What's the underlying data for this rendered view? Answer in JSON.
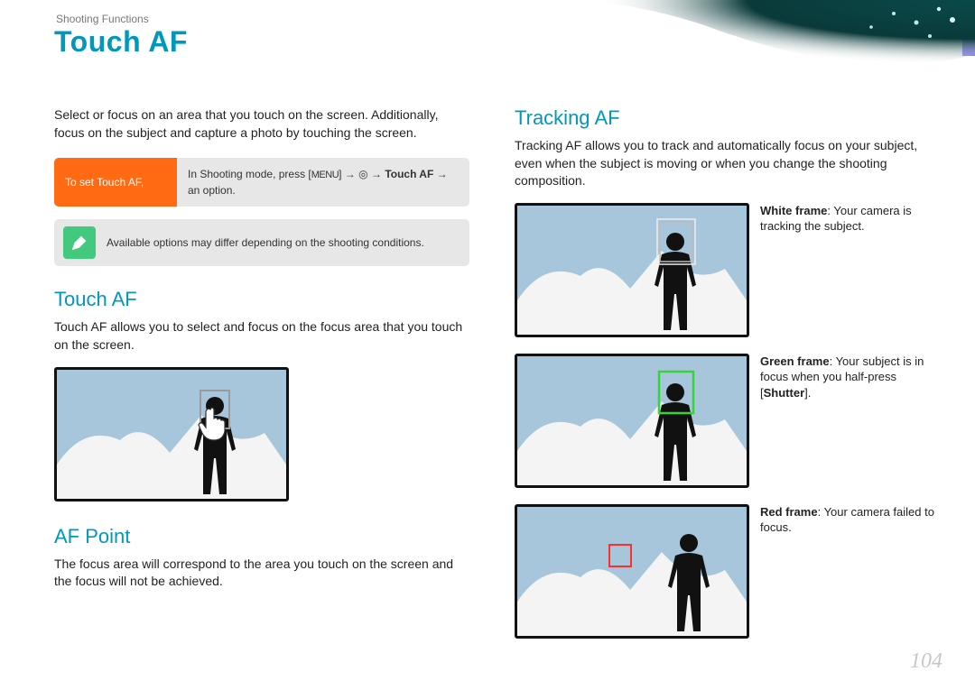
{
  "header": {
    "breadcrumb": "Shooting Functions",
    "title": "Touch AF"
  },
  "left": {
    "intro": "Select or focus on an area that you touch on the screen. Additionally, focus on the subject and capture a photo by touching the screen.",
    "step_label": "To set Touch AF,",
    "step_text_prefix": "In Shooting mode, press [",
    "step_menu": "MENU",
    "step_text_mid1": "] → ",
    "step_text_mid2": " → ",
    "step_text_bold": "Touch AF",
    "step_text_mid3": " → an option.",
    "note": "Available options may differ depending on the shooting conditions.",
    "h2a": "Touch AF",
    "body_a": "Touch AF allows you to select and focus on the focus area that you touch on the screen.",
    "h2b": "AF Point",
    "body_b": "The focus area will correspond to the area you touch on the screen and the focus will not be achieved."
  },
  "right": {
    "h2": "Tracking AF",
    "intro": "Tracking AF allows you to track and automatically focus on your subject, even when the subject is moving or when you change the shooting composition.",
    "cap_white_b": "White frame",
    "cap_white": ": Your camera is tracking the subject.",
    "cap_green_b": "Green frame",
    "cap_green_1": ": Your subject is in focus when you half-press [",
    "cap_green_sh": "Shutter",
    "cap_green_2": "].",
    "cap_red_b": "Red frame",
    "cap_red": ": Your camera failed to focus."
  },
  "page_number": "104",
  "icons": {
    "camera_glyph": "◎"
  }
}
